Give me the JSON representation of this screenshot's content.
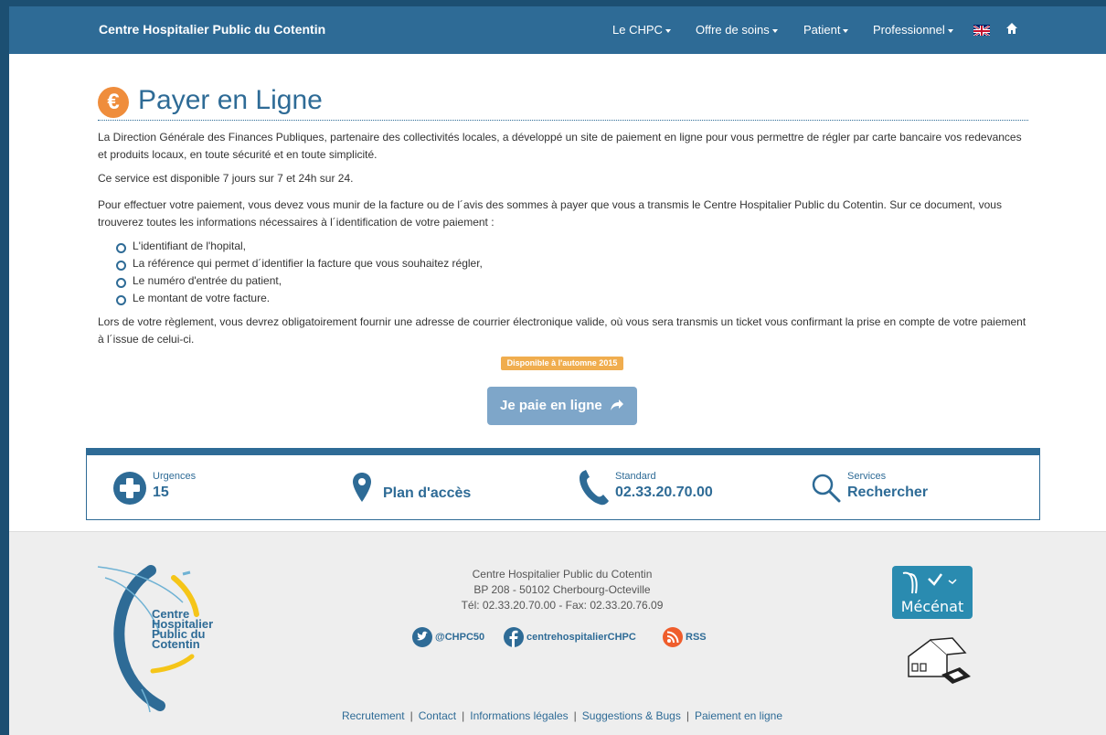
{
  "header": {
    "brand": "Centre Hospitalier Public du Cotentin",
    "menu": [
      {
        "label": "Le CHPC"
      },
      {
        "label": "Offre de soins"
      },
      {
        "label": "Patient"
      },
      {
        "label": "Professionnel"
      }
    ],
    "flag_icon": "uk-flag-icon",
    "home_icon": "home-icon"
  },
  "main": {
    "title": "Payer en Ligne",
    "title_icon": "euro-icon",
    "title_icon_glyph": "€",
    "paragraphs": [
      "La Direction Générale des Finances Publiques, partenaire des collectivités locales, a développé un site de paiement en ligne pour vous permettre de régler par carte bancaire vos redevances et produits locaux, en toute sécurité et en toute simplicité.",
      "Ce service est disponible 7 jours sur 7 et 24h sur 24.",
      "Pour effectuer votre paiement, vous devez vous munir de la facture ou de l´avis des sommes à payer que vous a transmis le Centre Hospitalier Public du Cotentin. Sur ce document, vous trouverez toutes les informations nécessaires à l´identification de votre paiement :",
      "Lors de votre règlement, vous devrez obligatoirement fournir une adresse de courrier électronique valide, où vous sera transmis un ticket vous confirmant la prise en compte de votre paiement à l´issue de celui-ci."
    ],
    "bullets": [
      "L'identifiant de l'hopital,",
      "La référence qui permet d´identifier la facture que vous souhaitez régler,",
      "Le numéro d'entrée du patient,",
      "Le montant de votre facture."
    ],
    "badge": "Disponible à l'automne 2015",
    "pay_button": "Je paie en ligne"
  },
  "infobar": {
    "urgences": {
      "small": "Urgences",
      "big": "15",
      "icon": "plus-circle-icon"
    },
    "plan": {
      "big": "Plan d'accès",
      "icon": "map-marker-icon"
    },
    "standard": {
      "small": "Standard",
      "big": "02.33.20.70.00",
      "icon": "phone-icon"
    },
    "services": {
      "small": "Services",
      "big": "Rechercher",
      "icon": "search-icon"
    }
  },
  "footer": {
    "logo_lines": [
      "Centre",
      "Hospitalier",
      "Public du",
      "Cotentin"
    ],
    "address": [
      "Centre Hospitalier Public du Cotentin",
      "BP 208 - 50102 Cherbourg-Octeville",
      "Tél: 02.33.20.70.00 - Fax: 02.33.20.76.09"
    ],
    "social": {
      "twitter": "@CHPC50",
      "facebook": "centrehospitalierCHPC",
      "rss": "RSS"
    },
    "mecenat": "Mécénat",
    "links": [
      "Recrutement",
      "Contact",
      "Informations légales",
      "Suggestions & Bugs",
      "Paiement en ligne"
    ]
  },
  "colors": {
    "navbar": "#2e6b96",
    "accent": "#2e6b96",
    "euro_orange": "#ef8d3c",
    "badge": "#f0ad4e",
    "pay_button": "#7ea6c9"
  }
}
